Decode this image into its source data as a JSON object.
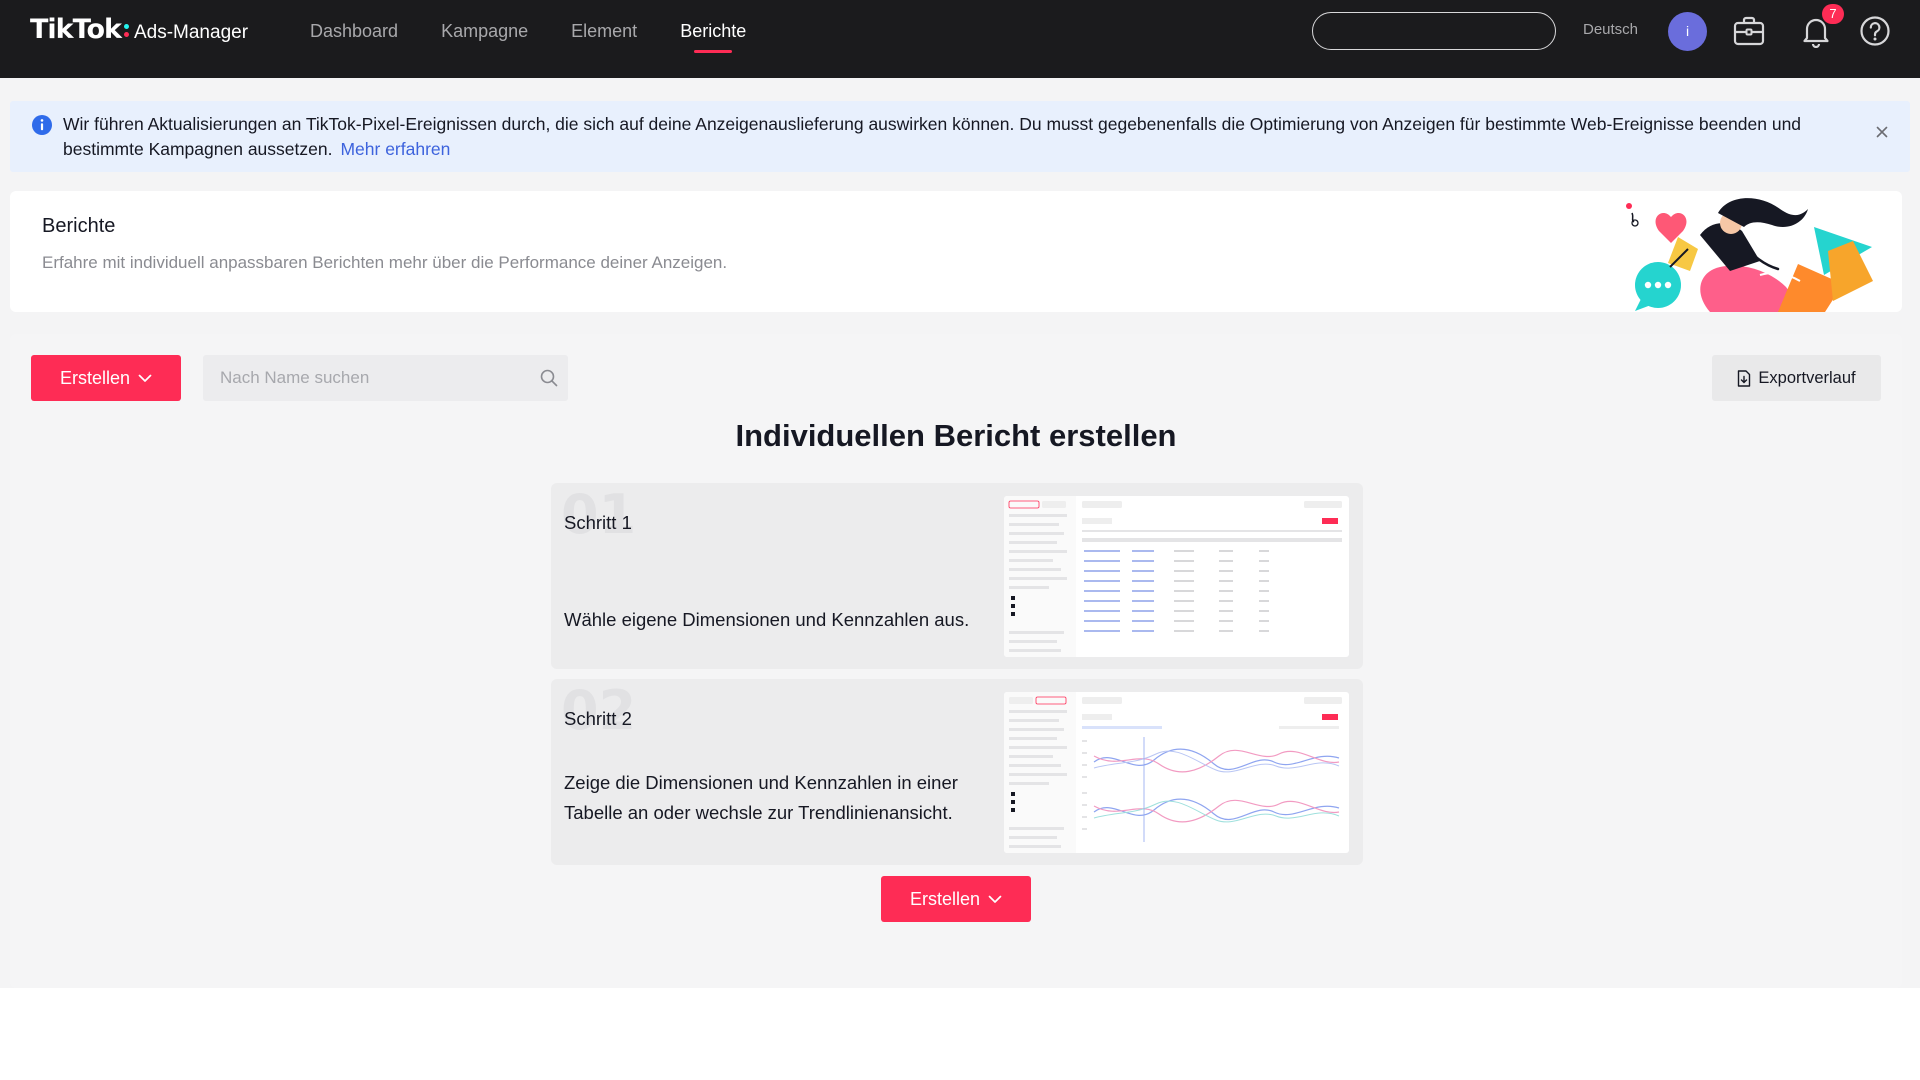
{
  "app": {
    "brand": "TikTok",
    "product": "Ads-Manager"
  },
  "nav": {
    "items": [
      {
        "label": "Dashboard",
        "active": false
      },
      {
        "label": "Kampagne",
        "active": false
      },
      {
        "label": "Element",
        "active": false
      },
      {
        "label": "Berichte",
        "active": true
      }
    ]
  },
  "header_bar": {
    "search_value": "",
    "language": "Deutsch",
    "avatar_initial": "i",
    "notification_count": "7",
    "icons": [
      "briefcase-icon",
      "bell-icon",
      "help-icon"
    ]
  },
  "notice": {
    "text": "Wir führen Aktualisierungen an TikTok-Pixel-Ereignissen durch, die sich auf deine Anzeigenauslieferung auswirken können. Du musst gegebenenfalls die Optimierung von Anzeigen für bestimmte Web-Ereignisse beenden und bestimmte Kampagnen aussetzen.",
    "link": "Mehr erfahren"
  },
  "page_header": {
    "title": "Berichte",
    "subtitle": "Erfahre mit individuell anpassbaren Berichten mehr über die Performance deiner Anzeigen."
  },
  "toolbar": {
    "create_label": "Erstellen",
    "search_placeholder": "Nach Name suchen",
    "export_label": "Exportverlauf"
  },
  "empty_state": {
    "title": "Individuellen Bericht erstellen",
    "steps": [
      {
        "number": "01",
        "label": "Schritt 1",
        "description": "Wähle eigene Dimensionen und Kennzahlen aus."
      },
      {
        "number": "02",
        "label": "Schritt 2",
        "description": "Zeige die Dimensionen und Kennzahlen in einer Tabelle an oder wechsle zur Trendlinienansicht."
      }
    ],
    "create_label": "Erstellen"
  },
  "colors": {
    "accent": "#fe2c55",
    "topbar": "#1b1b1d",
    "link": "#3d63dd",
    "avatar": "#6a6ddc",
    "notice_bg": "#e8f0fd"
  }
}
